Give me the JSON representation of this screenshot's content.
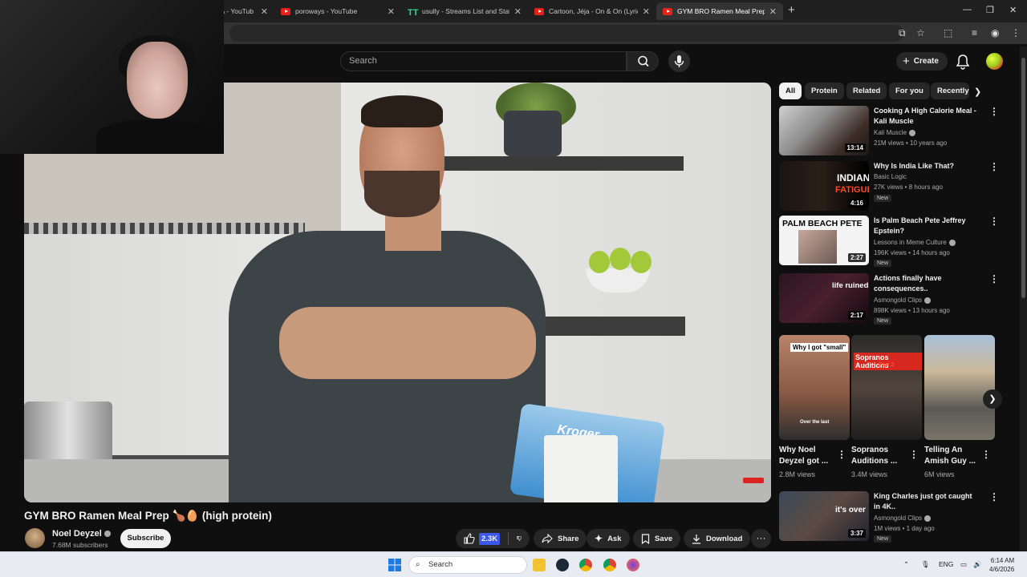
{
  "browser": {
    "tabs": [
      {
        "label": "LA - YouTub",
        "icon": "youtube-icon"
      },
      {
        "label": "poroways - YouTube",
        "icon": "youtube-icon"
      },
      {
        "label": "usully - Streams List and Statistic",
        "icon": "tt-icon"
      },
      {
        "label": "Cartoon, Jéja - On & On (Lyrics)",
        "icon": "youtube-icon"
      },
      {
        "label": "GYM BRO Ramen Meal Prep 🍗🥚 (h",
        "icon": "youtube-icon"
      }
    ],
    "new_tab": "+"
  },
  "header": {
    "search_placeholder": "Search",
    "create_label": "Create"
  },
  "video": {
    "title": "GYM BRO Ramen Meal Prep 🍗🥚 (high protein)",
    "bag_brand": "Kroger",
    "channel": {
      "name": "Noel Deyzel",
      "subscribers": "7.68M subscribers",
      "subscribe_label": "Subscribe"
    },
    "actions": {
      "like_count": "2.3K",
      "share": "Share",
      "ask": "Ask",
      "save": "Save",
      "download": "Download",
      "more": "···"
    }
  },
  "sidebar": {
    "chips": [
      "All",
      "Protein",
      "Related",
      "For you",
      "Recently"
    ],
    "recommendations": [
      {
        "title": "Cooking A High Calorie Meal - Kali Muscle",
        "channel": "Kali Muscle",
        "meta": "21M views • 10 years ago",
        "duration": "13:14",
        "is_new": false
      },
      {
        "title": "Why Is India Like That?",
        "channel": "Basic Logic",
        "meta": "27K views • 8 hours ago",
        "duration": "4:16",
        "is_new": true,
        "thumb_text": [
          "INDIAN",
          "FATIGUE"
        ]
      },
      {
        "title": "Is Palm Beach Pete Jeffrey Epstein?",
        "channel": "Lessons in Meme Culture",
        "meta": "196K views • 14 hours ago",
        "duration": "2:27",
        "is_new": true,
        "thumb_text": [
          "PALM BEACH PETE"
        ]
      },
      {
        "title": "Actions finally have consequences..",
        "channel": "Asmongold Clips",
        "meta": "898K views • 13 hours ago",
        "duration": "2:17",
        "is_new": true,
        "thumb_text": [
          "life ruined"
        ]
      }
    ],
    "shorts": [
      {
        "title": "Why Noel Deyzel got ...",
        "views": "2.8M views",
        "thumb_text": [
          "Why I got \"small\"",
          "Over the last"
        ]
      },
      {
        "title": "Sopranos Auditions ...",
        "views": "3.4M views",
        "thumb_text": [
          "Sopranos Auditions",
          "Part 2"
        ]
      },
      {
        "title": "Telling An Amish Guy ...",
        "views": "6M views"
      }
    ],
    "after_shorts": [
      {
        "title": "King Charles just got caught in 4K..",
        "channel": "Asmongold Clips",
        "meta": "1M views • 1 day ago",
        "duration": "3:37",
        "is_new": true,
        "thumb_text": [
          "it's over"
        ]
      }
    ],
    "new_badge": "New"
  },
  "taskbar": {
    "search_label": "Search",
    "language": "ENG",
    "time": "6:14 AM",
    "date": "4/6/2026"
  }
}
